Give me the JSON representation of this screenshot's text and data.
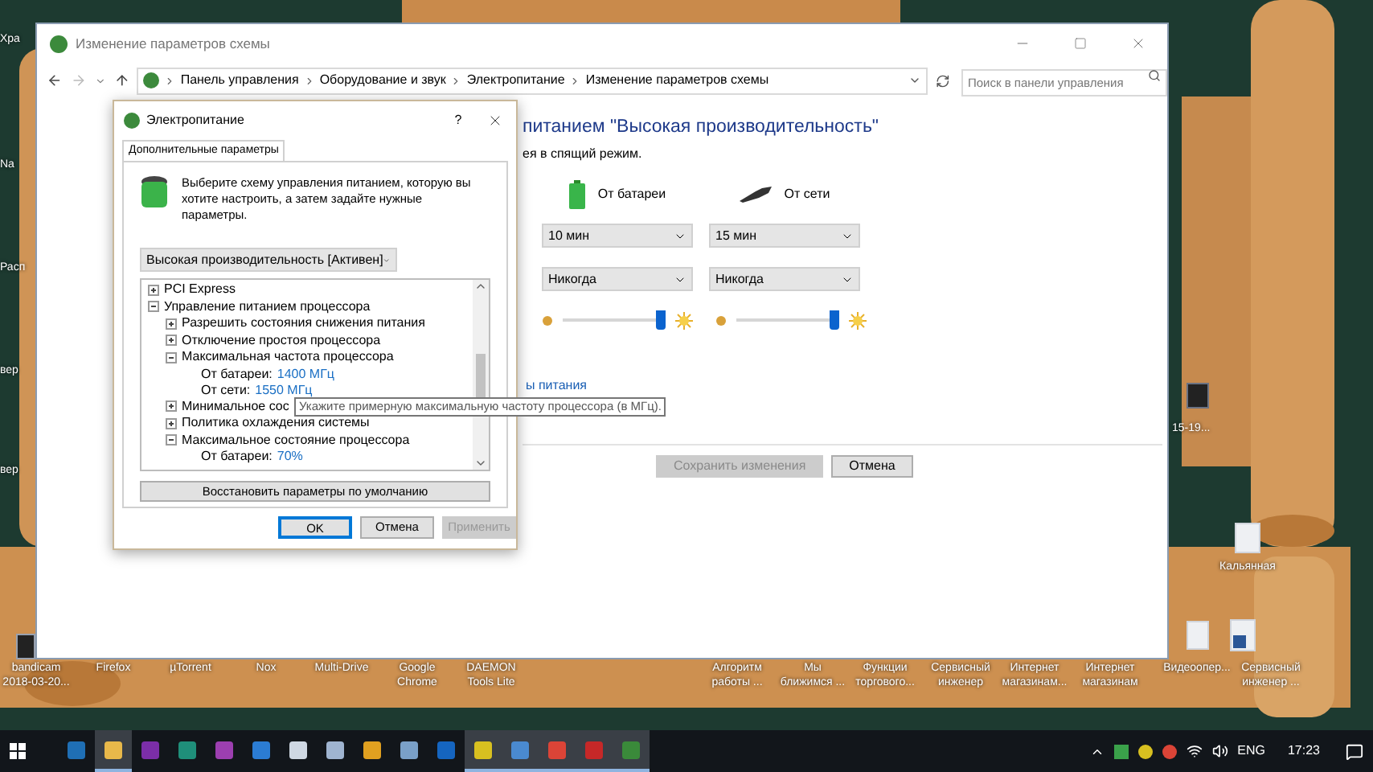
{
  "desktop": {
    "left_icons": [
      "Хра",
      "Na",
      "Расп",
      "вер",
      "вер"
    ],
    "right_icons": [
      "15-19...",
      "Кальянная"
    ],
    "bottom_icons": [
      "bandicam 2018-03-20...",
      "Firefox",
      "µTorrent",
      "Nox",
      "Multi-Drive",
      "Google Chrome",
      "DAEMON Tools Lite",
      "Алгоритм работы ...",
      "Мы ближимся ...",
      "Функции торгового...",
      "Сервисный инженер",
      "Интернет магазинам...",
      "Интернет магазинам",
      "Видеоопер...",
      "Сервисный инженер ..."
    ]
  },
  "main_window": {
    "title": "Изменение параметров схемы",
    "breadcrumb": [
      "Панель управления",
      "Оборудование и звук",
      "Электропитание",
      "Изменение параметров схемы"
    ],
    "search": {
      "placeholder": "Поиск в панели управления"
    },
    "heading": "питанием \"Высокая производительность\"",
    "subtext": "ея в спящий режим.",
    "columns": [
      "От батареи",
      "От сети"
    ],
    "rows": [
      [
        "10 мин",
        "15 мин"
      ],
      [
        "Никогда",
        "Никогда"
      ]
    ],
    "brightness": [
      {
        "level": 0.95
      },
      {
        "level": 0.95
      }
    ],
    "link": "ы питания",
    "buttons": [
      {
        "label": "Сохранить изменения",
        "disabled": true
      },
      {
        "label": "Отмена",
        "disabled": false
      }
    ]
  },
  "dialog": {
    "title": "Электропитание",
    "help_button": "?",
    "tab": {
      "label": "Дополнительные параметры",
      "selected": true
    },
    "intro": "Выберите схему управления питанием, которую вы хотите настроить, а затем задайте нужные параметры.",
    "scheme": "Высокая производительность [Активен]",
    "tree": [
      {
        "kind": "group",
        "label": "PCI Express",
        "expanded": false
      },
      {
        "kind": "group",
        "label": "Управление питанием процессора",
        "expanded": true,
        "children": [
          {
            "kind": "group",
            "label": "Разрешить состояния снижения питания",
            "expanded": false
          },
          {
            "kind": "group",
            "label": "Отключение простоя процессора",
            "expanded": false
          },
          {
            "kind": "group",
            "label": "Максимальная частота процессора",
            "expanded": true,
            "children": [
              {
                "kind": "setting",
                "label": "От батареи:",
                "value": "1400 МГц"
              },
              {
                "kind": "setting",
                "label": "От сети:",
                "value": "1550 МГц"
              }
            ]
          },
          {
            "kind": "group",
            "label": "Минимальное сос",
            "expanded": false
          },
          {
            "kind": "group",
            "label": "Политика охлаждения системы",
            "expanded": false
          },
          {
            "kind": "group",
            "label": "Максимальное состояние процессора",
            "expanded": true,
            "children": [
              {
                "kind": "setting",
                "label": "От батареи:",
                "value": "70%"
              }
            ]
          }
        ]
      }
    ],
    "restore_button": "Восстановить параметры по умолчанию",
    "buttons": [
      {
        "label": "OK",
        "disabled": false,
        "default": true
      },
      {
        "label": "Отмена",
        "disabled": false,
        "default": false
      },
      {
        "label": "Применить",
        "disabled": true,
        "default": false
      }
    ]
  },
  "tooltip": "Укажите примерную максимальную частоту процессора (в МГц).",
  "taskbar": {
    "apps": [
      {
        "running": false
      },
      {
        "running": true
      },
      {
        "running": false
      },
      {
        "running": false
      },
      {
        "running": false
      },
      {
        "running": false
      },
      {
        "running": false
      },
      {
        "running": false
      },
      {
        "running": false
      },
      {
        "running": false
      },
      {
        "running": false
      },
      {
        "running": true
      },
      {
        "running": true
      },
      {
        "running": true
      },
      {
        "running": true
      },
      {
        "running": true
      }
    ],
    "language": "ENG",
    "time": "17:23"
  }
}
